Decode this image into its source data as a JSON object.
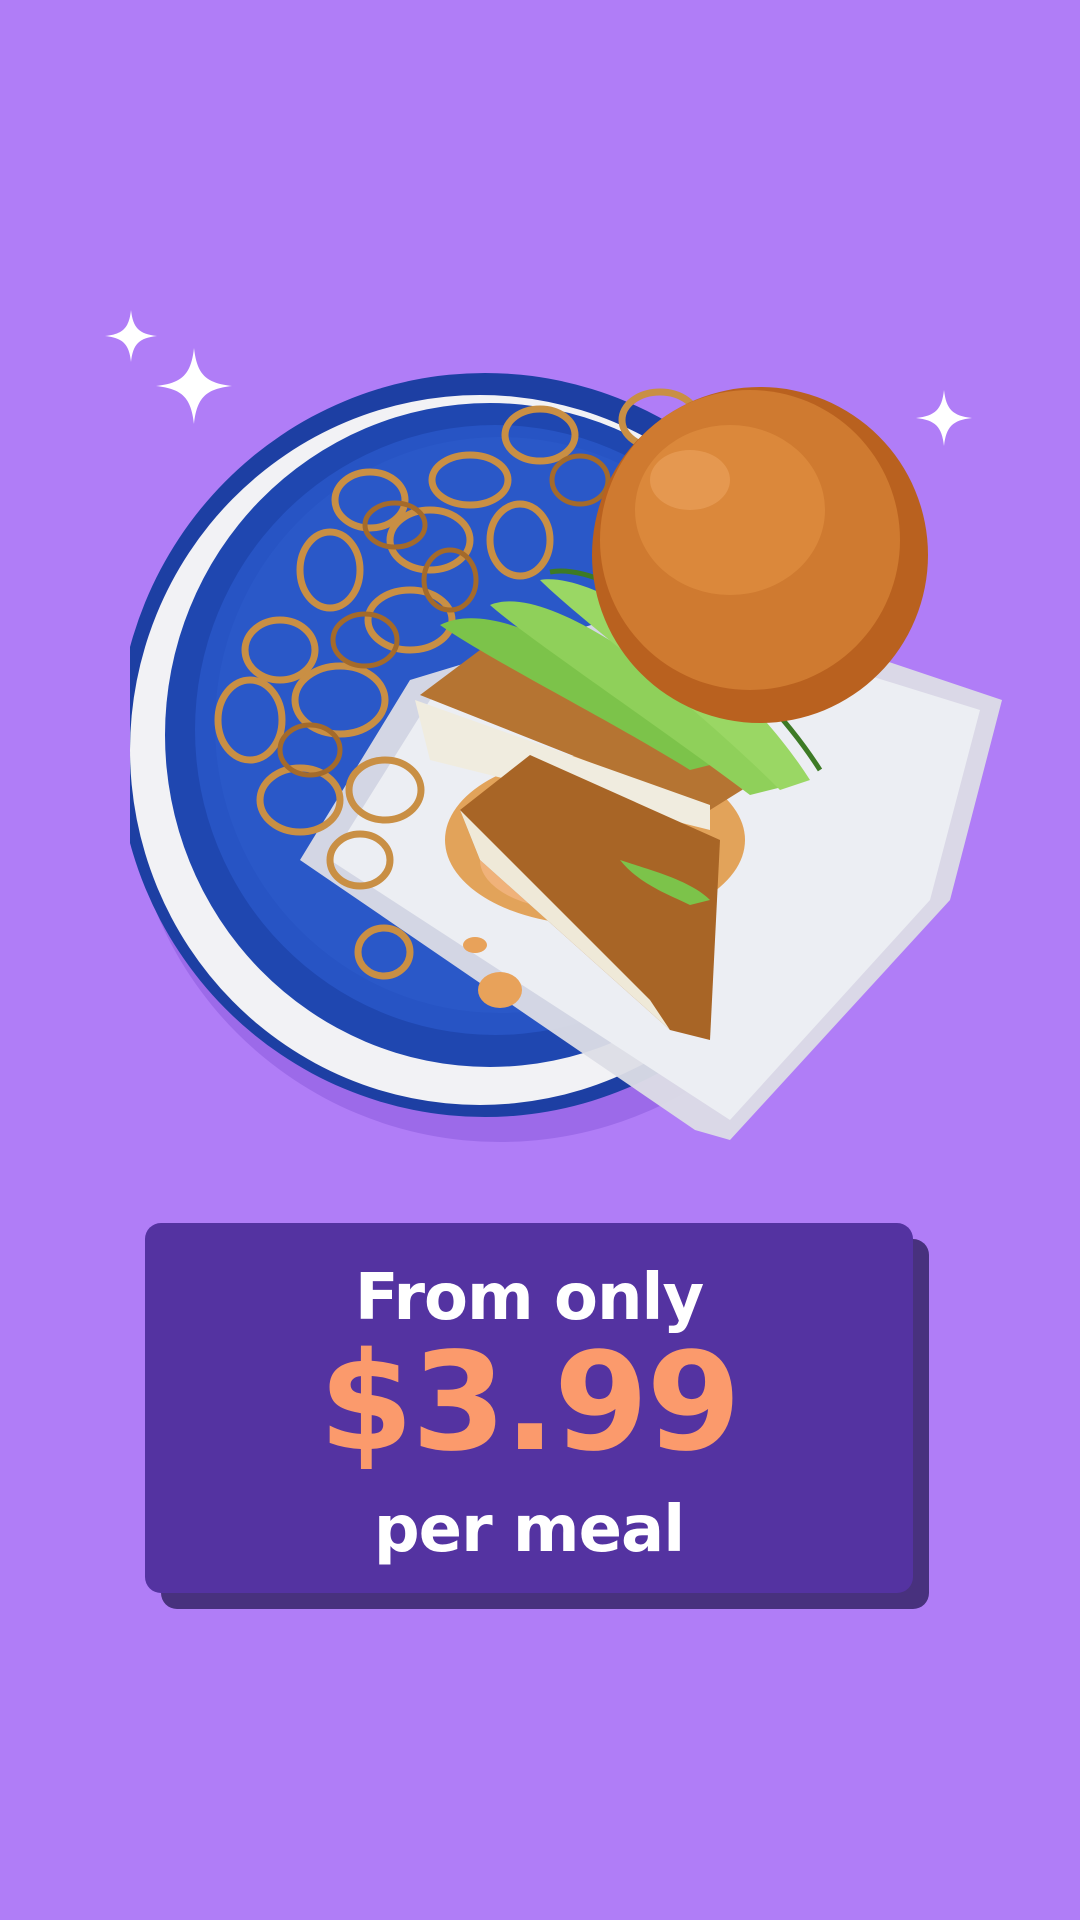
{
  "theme": {
    "background": "#b07df7",
    "card": "#5433a1",
    "card_shadow": "#48317e",
    "price_accent": "#fb9a6c",
    "text": "#ffffff"
  },
  "illustration": {
    "subject": "crispy chicken sandwich with avocado and fried onion strings on a blue plate",
    "icons": [
      "sparkle-icon",
      "sparkle-icon",
      "sparkle-icon"
    ]
  },
  "promo": {
    "prefix": "From only",
    "price": "$3.99",
    "suffix": "per meal"
  }
}
